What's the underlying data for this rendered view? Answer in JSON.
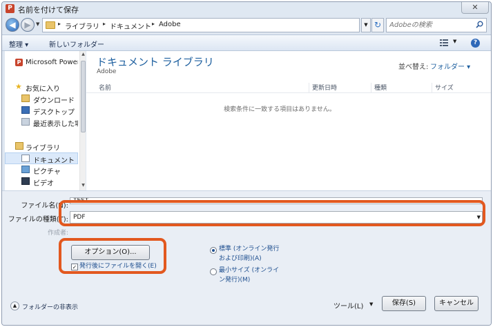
{
  "window": {
    "title": "名前を付けて保存",
    "close_label": "✕"
  },
  "address": {
    "crumbs": [
      "ライブラリ",
      "ドキュメント",
      "Adobe"
    ],
    "search_placeholder": "Adobeの検索"
  },
  "toolbar": {
    "organize": "整理 ▾",
    "new_folder": "新しいフォルダー"
  },
  "nav": {
    "items": [
      {
        "label": "Microsoft PowerP"
      },
      {
        "label": "お気に入り"
      },
      {
        "label": "ダウンロード"
      },
      {
        "label": "デスクトップ"
      },
      {
        "label": "最近表示した場所"
      },
      {
        "label": "ライブラリ"
      },
      {
        "label": "ドキュメント"
      },
      {
        "label": "ピクチャ"
      },
      {
        "label": "ビデオ"
      }
    ]
  },
  "content": {
    "title": "ドキュメント ライブラリ",
    "subtitle": "Adobe",
    "arrange_label": "並べ替え:",
    "arrange_value": "フォルダー ▾",
    "columns": [
      "名前",
      "更新日時",
      "種類",
      "サイズ"
    ],
    "empty_message": "検索条件に一致する項目はありません。"
  },
  "form": {
    "filename_label": "ファイル名(N):",
    "filename_value": "TEST",
    "filetype_label": "ファイルの種類(T):",
    "filetype_value": "PDF",
    "authors_label": "作成者:",
    "options_button": "オプション(O)...",
    "open_after_label": "発行後にファイルを開く(E)",
    "radio_standard": "標準 (オンライン発行および印刷)(A)",
    "radio_minimum": "最小サイズ (オンライン発行)(M)",
    "hide_folders": "フォルダーの非表示",
    "tools": "ツール(L)",
    "save": "保存(S)",
    "cancel": "キャンセル"
  },
  "colors": {
    "highlight": "#e2581f",
    "accent": "#1d5f9f"
  }
}
